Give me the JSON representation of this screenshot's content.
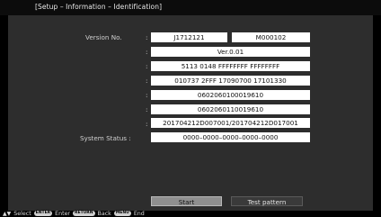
{
  "header": {
    "breadcrumb": "[Setup – Information – Identification]"
  },
  "info": {
    "version_label": "Version No.",
    "version_main": "J1712121",
    "version_sub": "M000102",
    "rows": [
      "Ver.0.01",
      "5113 0148 FFFFFFFF FFFFFFFF",
      "010737 2FFF 17090700 17101330",
      "0602060100019610",
      "0602060110019610",
      "201704212D007001/201704212D017001"
    ],
    "status_label": "System Status :",
    "status_value": "0000–0000–0000–0000–0000"
  },
  "buttons": {
    "start_label": "Start",
    "test_label": "Test pattern"
  },
  "footer": {
    "select_text": "Select",
    "enter_key": "ENTER",
    "enter_text": "Enter",
    "return_key": "RETURN",
    "back_text": "Back",
    "menu_key": "MENU",
    "end_text": "End"
  },
  "colors": {
    "background": "#000000",
    "panel": "#2d2d2d",
    "field": "#ffffff",
    "button_selected": "#8f8f8f"
  }
}
